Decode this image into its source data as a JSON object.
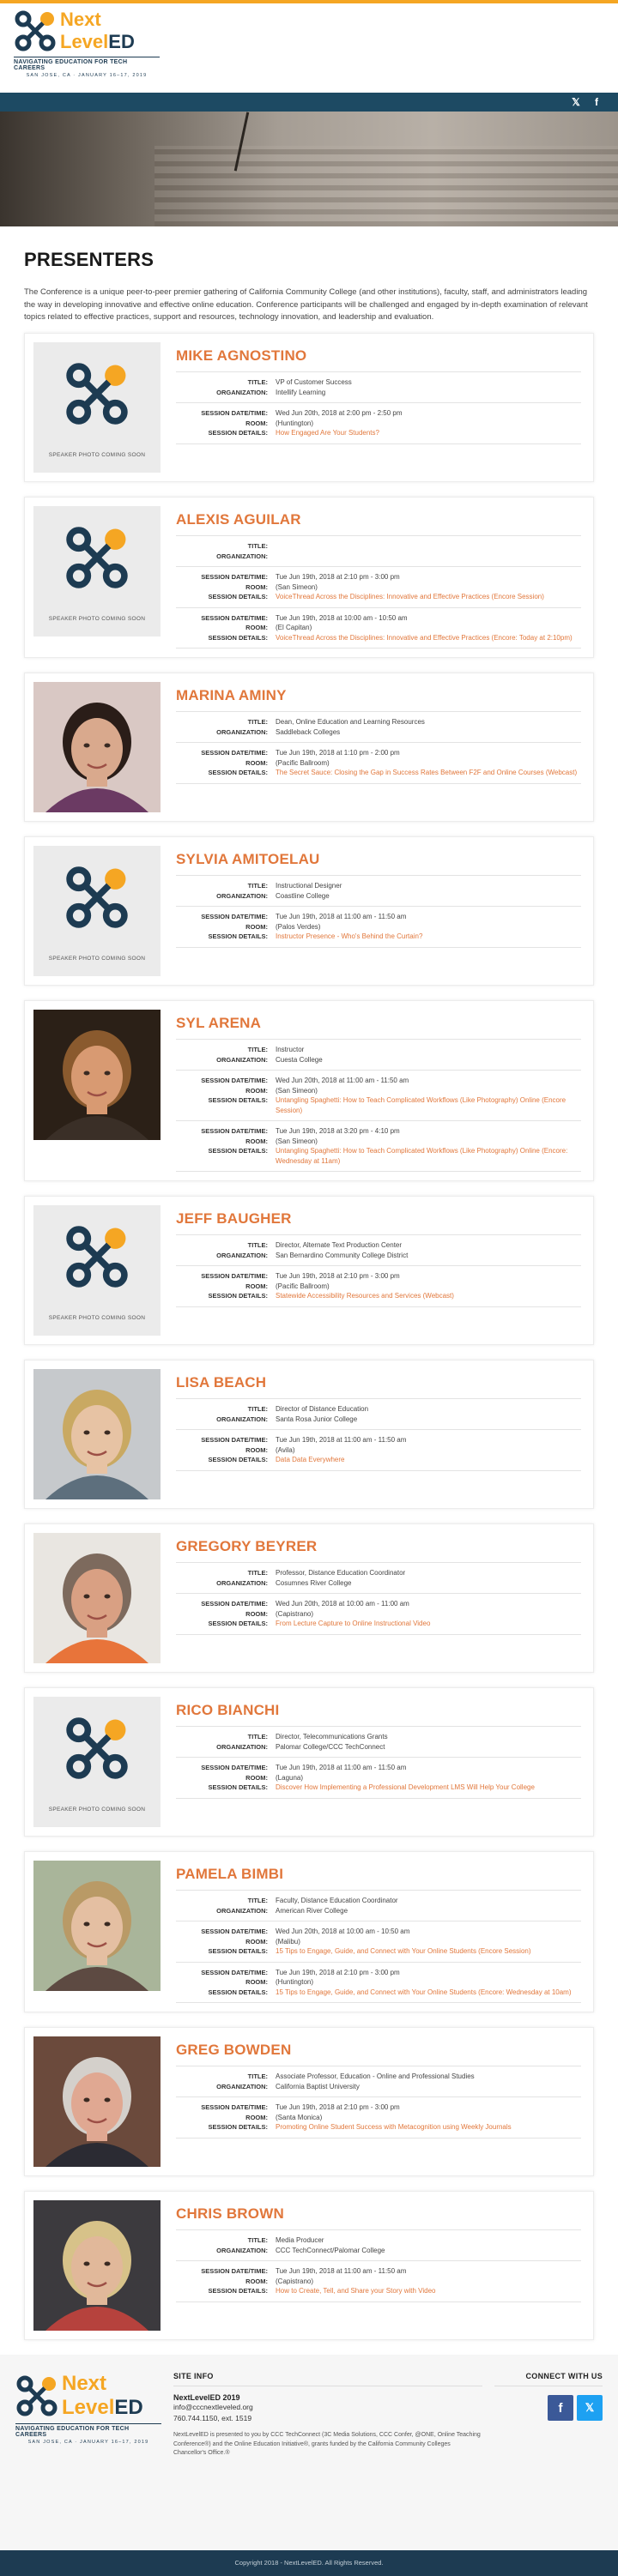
{
  "brand": {
    "line1": "Next",
    "line2a": "Level",
    "line2b": "ED",
    "tagline": "NAVIGATING EDUCATION FOR TECH CAREERS",
    "dateline": "SAN JOSE, CA · JANUARY 16–17, 2019",
    "colors": {
      "accent": "#f5a623",
      "navy": "#1d3b52",
      "link": "#e1773b"
    }
  },
  "nav": {
    "social": [
      "twitter-icon",
      "facebook-icon"
    ],
    "twitter_glyph": "𝕏",
    "facebook_glyph": "f"
  },
  "page": {
    "title": "PRESENTERS",
    "intro": "The Conference is a unique peer-to-peer premier gathering of California Community College (and other institutions), faculty, staff, and administrators leading the way in developing innovative and effective online education. Conference participants will be challenged and engaged by in-depth examination of relevant topics related to effective practices, support and resources, technology innovation, and leadership and evaluation."
  },
  "labels": {
    "title": "TITLE:",
    "organization": "ORGANIZATION:",
    "datetime": "SESSION DATE/TIME:",
    "room": "ROOM:",
    "details": "SESSION DETAILS:",
    "photo_soon": "SPEAKER PHOTO COMING SOON"
  },
  "presenters": [
    {
      "name": "MIKE AGNOSTINO",
      "photo": "placeholder",
      "title": "VP of Customer Success",
      "organization": "Intellify Learning",
      "sessions": [
        {
          "datetime": "Wed Jun 20th, 2018 at 2:00 pm - 2:50 pm",
          "room": "(Huntington)",
          "details": "How Engaged Are Your Students?"
        }
      ]
    },
    {
      "name": "ALEXIS AGUILAR",
      "photo": "placeholder",
      "title": "",
      "organization": "",
      "sessions": [
        {
          "datetime": "Tue Jun 19th, 2018 at 2:10 pm - 3:00 pm",
          "room": "(San Simeon)",
          "details": "VoiceThread Across the Disciplines: Innovative and Effective Practices (Encore Session)"
        },
        {
          "datetime": "Tue Jun 19th, 2018 at 10:00 am - 10:50 am",
          "room": "(El Capitan)",
          "details": "VoiceThread Across the Disciplines: Innovative and Effective Practices (Encore: Today at 2:10pm)"
        }
      ]
    },
    {
      "name": "MARINA AMINY",
      "photo": "woman-dark-hair",
      "title": "Dean, Online Education and Learning Resources",
      "organization": "Saddleback Colleges",
      "sessions": [
        {
          "datetime": "Tue Jun 19th, 2018 at 1:10 pm - 2:00 pm",
          "room": "(Pacific Ballroom)",
          "details": "The Secret Sauce: Closing the Gap in Success Rates Between F2F and Online Courses (Webcast)"
        }
      ]
    },
    {
      "name": "SYLVIA AMITOELAU",
      "photo": "placeholder",
      "title": "Instructional Designer",
      "organization": "Coastline College",
      "sessions": [
        {
          "datetime": "Tue Jun 19th, 2018 at 11:00 am - 11:50 am",
          "room": "(Palos Verdes)",
          "details": "Instructor Presence - Who's Behind the Curtain?"
        }
      ]
    },
    {
      "name": "SYL ARENA",
      "photo": "man-curly-hair",
      "title": "Instructor",
      "organization": "Cuesta College",
      "sessions": [
        {
          "datetime": "Wed Jun 20th, 2018 at 11:00 am - 11:50 am",
          "room": "(San Simeon)",
          "details": "Untangling Spaghetti: How to Teach Complicated Workflows (Like Photography) Online (Encore Session)"
        },
        {
          "datetime": "Tue Jun 19th, 2018 at 3:20 pm - 4:10 pm",
          "room": "(San Simeon)",
          "details": "Untangling Spaghetti: How to Teach Complicated Workflows (Like Photography) Online (Encore: Wednesday at 11am)"
        }
      ]
    },
    {
      "name": "JEFF BAUGHER",
      "photo": "placeholder",
      "title": "Director, Alternate Text Production Center",
      "organization": "San Bernardino Community College District",
      "sessions": [
        {
          "datetime": "Tue Jun 19th, 2018 at 2:10 pm - 3:00 pm",
          "room": "(Pacific Ballroom)",
          "details": "Statewide Accessibility Resources and Services (Webcast)"
        }
      ]
    },
    {
      "name": "LISA BEACH",
      "photo": "woman-blonde",
      "title": "Director of Distance Education",
      "organization": "Santa Rosa Junior College",
      "sessions": [
        {
          "datetime": "Tue Jun 19th, 2018 at 11:00 am - 11:50 am",
          "room": "(Avila)",
          "details": "Data Data Everywhere"
        }
      ]
    },
    {
      "name": "GREGORY BEYRER",
      "photo": "man-orange-shirt",
      "title": "Professor, Distance Education Coordinator",
      "organization": "Cosumnes River College",
      "sessions": [
        {
          "datetime": "Wed Jun 20th, 2018 at 10:00 am - 11:00 am",
          "room": "(Capistrano)",
          "details": "From Lecture Capture to Online Instructional Video"
        }
      ]
    },
    {
      "name": "RICO BIANCHI",
      "photo": "placeholder",
      "title": "Director, Telecommunications Grants",
      "organization": "Palomar College/CCC TechConnect",
      "sessions": [
        {
          "datetime": "Tue Jun 19th, 2018 at 11:00 am - 11:50 am",
          "room": "(Laguna)",
          "details": "Discover How Implementing a Professional Development LMS Will Help Your College"
        }
      ]
    },
    {
      "name": "PAMELA BIMBI",
      "photo": "woman-glasses",
      "title": "Faculty, Distance Education Coordinator",
      "organization": "American River College",
      "sessions": [
        {
          "datetime": "Wed Jun 20th, 2018 at 10:00 am - 10:50 am",
          "room": "(Malibu)",
          "details": "15 Tips to Engage, Guide, and Connect with Your Online Students (Encore Session)"
        },
        {
          "datetime": "Tue Jun 19th, 2018 at 2:10 pm - 3:00 pm",
          "room": "(Huntington)",
          "details": "15 Tips to Engage, Guide, and Connect with Your Online Students (Encore: Wednesday at 10am)"
        }
      ]
    },
    {
      "name": "GREG BOWDEN",
      "photo": "man-suit",
      "title": "Associate Professor, Education - Online and Professional Studies",
      "organization": "California Baptist University",
      "sessions": [
        {
          "datetime": "Tue Jun 19th, 2018 at 2:10 pm - 3:00 pm",
          "room": "(Santa Monica)",
          "details": "Promoting Online Student Success with Metacognition using Weekly Journals"
        }
      ]
    },
    {
      "name": "CHRIS BROWN",
      "photo": "man-red-shirt",
      "title": "Media Producer",
      "organization": "CCC TechConnect/Palomar College",
      "sessions": [
        {
          "datetime": "Tue Jun 19th, 2018 at 11:00 am - 11:50 am",
          "room": "(Capistrano)",
          "details": "How to Create, Tell, and Share your Story with Video"
        }
      ]
    }
  ],
  "footer": {
    "site_info_heading": "SITE INFO",
    "event_name": "NextLevelED 2019",
    "email": "info@cccnextleveled.org",
    "phone": "760.744.1150, ext. 1519",
    "fine_print": "NextLevelED is presented to you by CCC TechConnect (3C Media Solutions, CCC Confer, @ONE, Online Teaching Conference®) and the Online Education Initiative®, grants funded by the California Community Colleges Chancellor's Office.®",
    "connect_heading": "CONNECT WITH US",
    "facebook_glyph": "f",
    "twitter_glyph": "𝕏",
    "copyright": "Copyright 2018 - NextLevelED. All Rights Reserved."
  }
}
